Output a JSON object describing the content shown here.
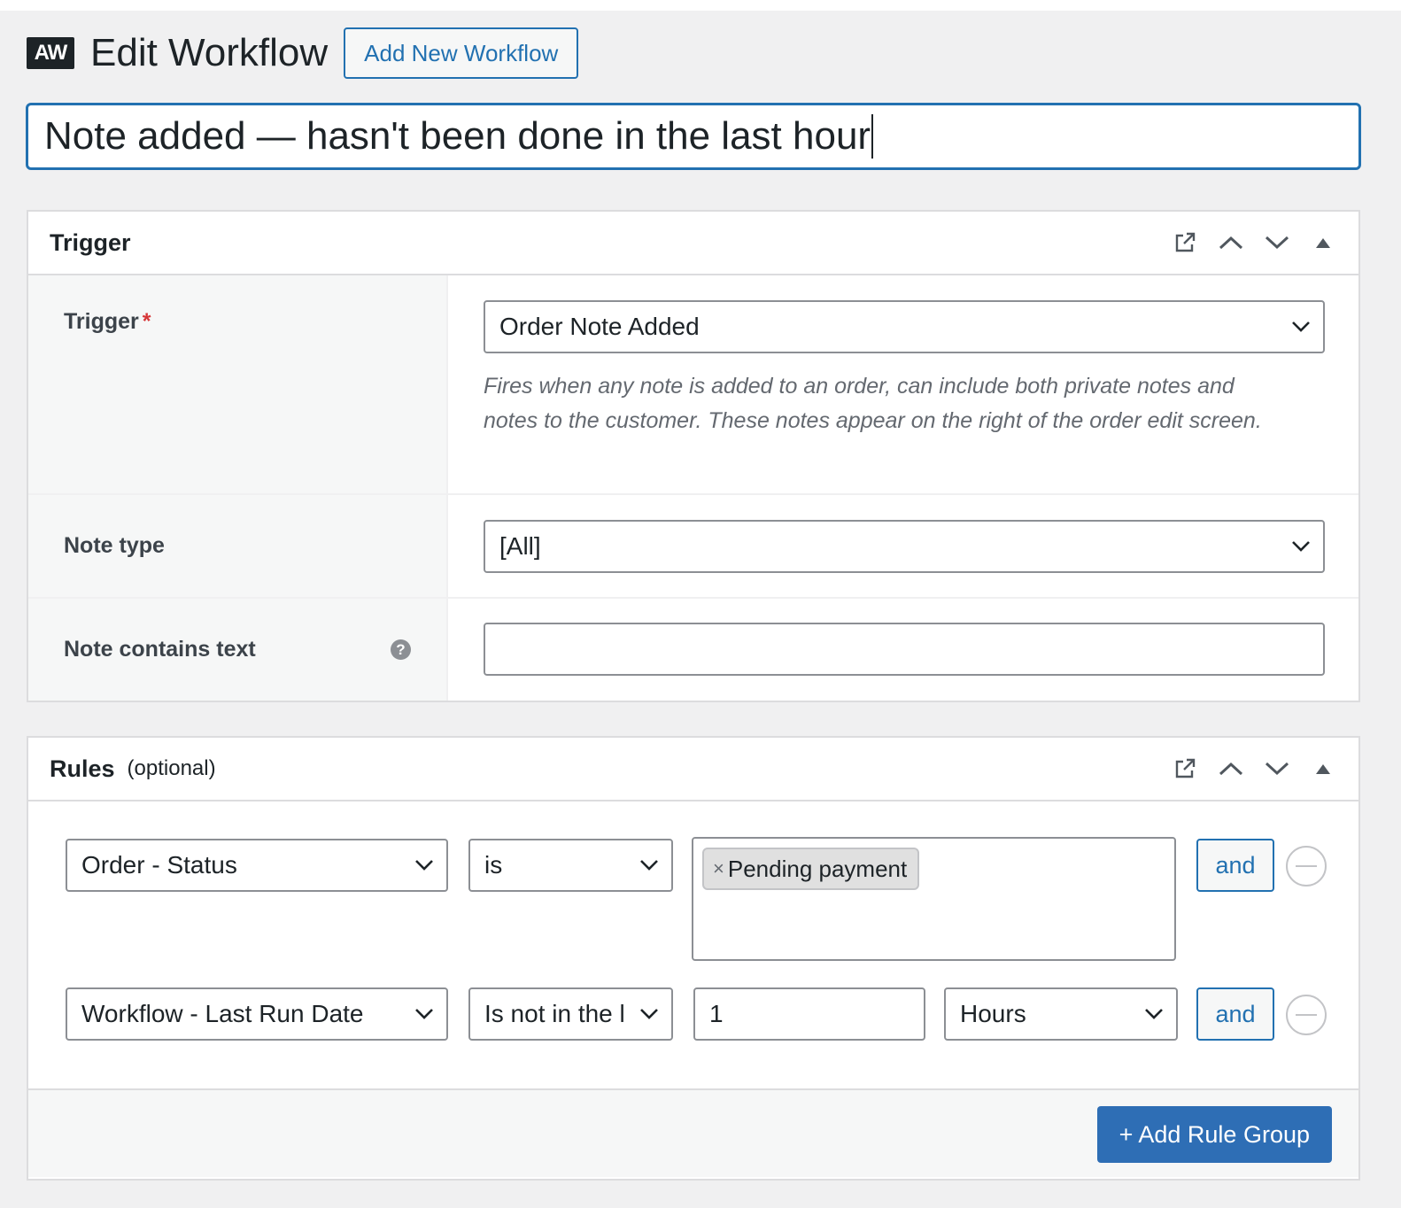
{
  "header": {
    "logo_text": "AW",
    "title": "Edit Workflow",
    "add_new_label": "Add New Workflow"
  },
  "workflow_title": "Note added — hasn't been done in the last hour",
  "trigger_box": {
    "title": "Trigger",
    "trigger_label": "Trigger",
    "required_mark": "*",
    "trigger_value": "Order Note Added",
    "trigger_description": "Fires when any note is added to an order, can include both private notes and notes to the customer. These notes appear on the right of the order edit screen.",
    "note_type_label": "Note type",
    "note_type_value": "[All]",
    "note_contains_label": "Note contains text",
    "note_contains_value": "",
    "help_glyph": "?"
  },
  "rules_box": {
    "title": "Rules",
    "subtitle": "(optional)",
    "rule1": {
      "field": "Order - Status",
      "operator": "is",
      "tags": [
        "Pending payment"
      ],
      "tag_remove_glyph": "×",
      "and_label": "and"
    },
    "rule2": {
      "field": "Workflow - Last Run Date",
      "operator": "Is not in the l",
      "value": "1",
      "unit": "Hours",
      "and_label": "and"
    },
    "add_group_label": "+ Add Rule Group"
  },
  "icons": [
    "external-link-icon",
    "chevron-up-icon",
    "chevron-down-icon",
    "collapse-triangle-icon",
    "help-icon",
    "remove-rule-icon"
  ],
  "colors": {
    "accent": "#2271b1",
    "primary_button": "#2e6eb5",
    "required": "#d63638",
    "background": "#f0f0f1"
  }
}
